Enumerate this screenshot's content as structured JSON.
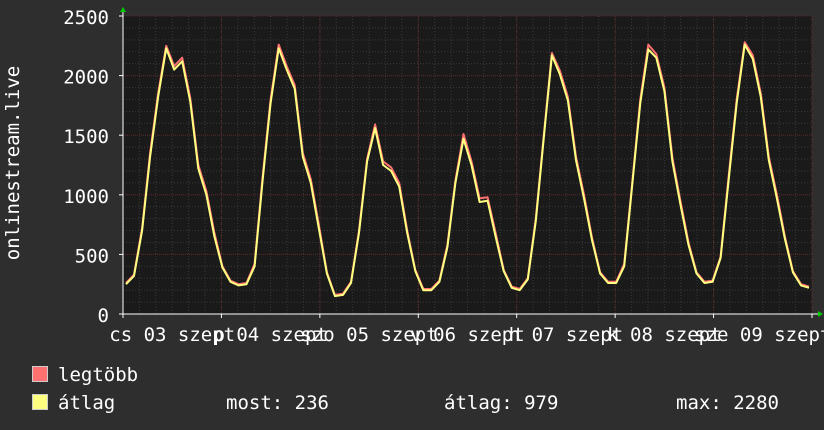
{
  "chart_data": {
    "type": "line",
    "ylabel": "onlinestream.live",
    "ylim": [
      0,
      2500
    ],
    "yticks": [
      "0",
      "500",
      "1000",
      "1500",
      "2000",
      "2500"
    ],
    "xticks": [
      "cs 03 szept",
      "p 04 szept",
      "szo 05 szept",
      "v 06 szept",
      "h 07 szept",
      "k 08 szept",
      "sze 09 szept"
    ],
    "grid": true,
    "colors": {
      "background": "#1a1a1a",
      "grid": "#5a2a2a",
      "axis": "#ffffff",
      "legtobb": "#ff7070",
      "atlag": "#ffff80"
    },
    "series": [
      {
        "name": "legtöbb",
        "color": "#ff7070",
        "values": [
          260,
          330,
          720,
          1350,
          1850,
          2250,
          2080,
          2150,
          1810,
          1250,
          1030,
          680,
          400,
          280,
          250,
          260,
          420,
          1150,
          1800,
          2260,
          2080,
          1920,
          1350,
          1130,
          750,
          350,
          160,
          170,
          270,
          700,
          1300,
          1590,
          1280,
          1230,
          1100,
          700,
          370,
          210,
          210,
          280,
          580,
          1120,
          1510,
          1280,
          970,
          980,
          680,
          370,
          230,
          210,
          300,
          800,
          1500,
          2190,
          2040,
          1820,
          1320,
          1000,
          640,
          350,
          270,
          270,
          420,
          1100,
          1800,
          2260,
          2180,
          1900,
          1310,
          950,
          600,
          350,
          270,
          280,
          480,
          1150,
          1800,
          2280,
          2170,
          1850,
          1320,
          1000,
          650,
          360,
          250,
          230
        ]
      },
      {
        "name": "átlag",
        "color": "#ffff80",
        "values": [
          250,
          320,
          700,
          1320,
          1820,
          2230,
          2050,
          2120,
          1780,
          1220,
          1000,
          650,
          390,
          270,
          240,
          250,
          400,
          1120,
          1770,
          2230,
          2050,
          1890,
          1320,
          1100,
          720,
          340,
          150,
          160,
          260,
          680,
          1280,
          1560,
          1250,
          1200,
          1070,
          680,
          360,
          200,
          200,
          270,
          560,
          1100,
          1470,
          1250,
          940,
          950,
          650,
          360,
          220,
          200,
          290,
          780,
          1480,
          2170,
          2010,
          1790,
          1290,
          970,
          620,
          340,
          260,
          260,
          400,
          1080,
          1770,
          2220,
          2150,
          1870,
          1280,
          920,
          580,
          340,
          260,
          270,
          470,
          1120,
          1770,
          2260,
          2140,
          1820,
          1290,
          970,
          630,
          350,
          240,
          220
        ]
      }
    ]
  },
  "legend": {
    "items": [
      {
        "label": "legtöbb",
        "color": "#ff7070"
      },
      {
        "label": "átlag",
        "color": "#ffff80"
      }
    ],
    "stats": {
      "most": "most: 236",
      "atlag": "átlag: 979",
      "max": "max: 2280"
    }
  }
}
